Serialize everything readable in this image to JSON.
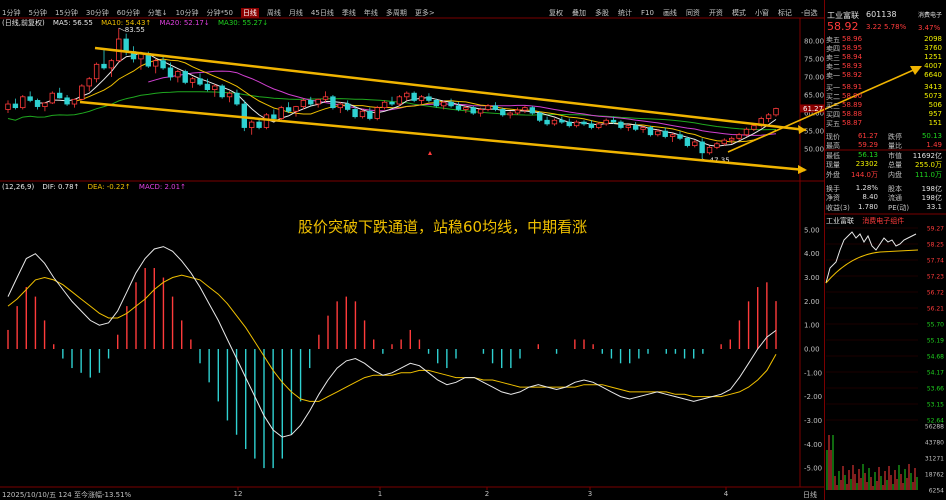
{
  "period_tabs": [
    "1分钟",
    "5分钟",
    "15分钟",
    "30分钟",
    "60分钟",
    "分笔↓",
    "10分钟",
    "分钟*50",
    "日线",
    "周线",
    "月线",
    "45日线",
    "季线",
    "年线",
    "多周期",
    "更多>"
  ],
  "active_tab": "日线",
  "toolbar": [
    "复权",
    "叠加",
    "多股",
    "统计",
    "F10",
    "画线",
    "同资",
    "开资",
    "模式",
    "小窗",
    "标记",
    "-自选"
  ],
  "price_indicator": {
    "prefix": "(日线,前复权)",
    "ma5": "MA5: 56.55",
    "ma10": "MA10: 54.43↑",
    "ma20": "MA20: 52.17↓",
    "ma30": "MA30: 55.27↓"
  },
  "macd_indicator": {
    "prefix": "(12,26,9)",
    "dif": "DIF: 0.78↑",
    "dea": "DEA: -0.22↑",
    "macd": "MACD: 2.01↑"
  },
  "annotation": "股价突破下跌通道，站稳60均线，中期看涨",
  "footer_text": "12025/10/10/五 124 至今涨幅-13.51%",
  "x_ticks": [
    "12",
    "1",
    "2",
    "3",
    "4"
  ],
  "period_label_bottom": "日线",
  "top_right_tag": "消费电子",
  "chart_data": [
    {
      "type": "candlestick",
      "price_axis_ticks": [
        "80.00",
        "75.00",
        "70.00",
        "65.00",
        "60.00",
        "55.00",
        "50.00"
      ],
      "ylim": [
        47,
        83
      ],
      "current_price_label": "61.27",
      "high_marker": "83.55",
      "low_marker": "47.35",
      "annotations": [
        "downtrend channel upper line",
        "downtrend channel lower line",
        "breakout arrow"
      ],
      "candles": [
        [
          61,
          63.5,
          60,
          62.5
        ],
        [
          62.5,
          64,
          61,
          61.5
        ],
        [
          61.5,
          65,
          61,
          64.5
        ],
        [
          64.5,
          66,
          63,
          63.5
        ],
        [
          63.5,
          64,
          61,
          61.8
        ],
        [
          61.8,
          63,
          60.5,
          62.8
        ],
        [
          62.8,
          66,
          62.5,
          65.5
        ],
        [
          65.5,
          67,
          64,
          64.2
        ],
        [
          64.2,
          65,
          62,
          62.5
        ],
        [
          62.5,
          64,
          61.5,
          63.8
        ],
        [
          63.8,
          68,
          63.5,
          67.5
        ],
        [
          67.5,
          70,
          66,
          69.5
        ],
        [
          69.5,
          74,
          68.5,
          73.5
        ],
        [
          73.5,
          78,
          72,
          72.5
        ],
        [
          72.5,
          75,
          70,
          74.5
        ],
        [
          74.5,
          83.55,
          74,
          80.5
        ],
        [
          80.5,
          82,
          76,
          77
        ],
        [
          77,
          78.5,
          74,
          75
        ],
        [
          75,
          77,
          72,
          76.5
        ],
        [
          76.5,
          77,
          72.5,
          73
        ],
        [
          73,
          75,
          71,
          74.5
        ],
        [
          74.5,
          76,
          72,
          72.5
        ],
        [
          72.5,
          74,
          69,
          70
        ],
        [
          70,
          72,
          68.5,
          71.5
        ],
        [
          71.5,
          72,
          68,
          68.5
        ],
        [
          68.5,
          70,
          67,
          69.5
        ],
        [
          69.5,
          71,
          67.5,
          68
        ],
        [
          68,
          69.5,
          66,
          66.5
        ],
        [
          66.5,
          68,
          64.5,
          67.5
        ],
        [
          67.5,
          68,
          64,
          64.5
        ],
        [
          64.5,
          66,
          63,
          65.5
        ],
        [
          65.5,
          66.5,
          62,
          62.5
        ],
        [
          62.5,
          63.5,
          55,
          56
        ],
        [
          56,
          58,
          54,
          57.5
        ],
        [
          57.5,
          58.5,
          55.5,
          56
        ],
        [
          56,
          60,
          55.5,
          59.5
        ],
        [
          59.5,
          61,
          58,
          58.5
        ],
        [
          58.5,
          62,
          58,
          61.5
        ],
        [
          61.5,
          63,
          60,
          60.5
        ],
        [
          60.5,
          62,
          59,
          61.8
        ],
        [
          61.8,
          64,
          61,
          63.5
        ],
        [
          63.5,
          64.5,
          62,
          62.5
        ],
        [
          62.5,
          64,
          61.5,
          63.8
        ],
        [
          63.8,
          66,
          63,
          64.5
        ],
        [
          64.5,
          65,
          61,
          61.5
        ],
        [
          61.5,
          63,
          60,
          62.5
        ],
        [
          62.5,
          63.5,
          60.5,
          61
        ],
        [
          61,
          62,
          58.5,
          59
        ],
        [
          59,
          61,
          58.5,
          60.5
        ],
        [
          60.5,
          61.5,
          58,
          58.5
        ],
        [
          58.5,
          62,
          58,
          61.5
        ],
        [
          61.5,
          63.5,
          61,
          63
        ],
        [
          63,
          64.5,
          62,
          62.5
        ],
        [
          62.5,
          65,
          62,
          64.5
        ],
        [
          64.5,
          66,
          63.5,
          65.5
        ],
        [
          65.5,
          66,
          63,
          63.5
        ],
        [
          63.5,
          65,
          62.5,
          64.5
        ],
        [
          64.5,
          65.5,
          63,
          63.5
        ],
        [
          63.5,
          64,
          61.5,
          62
        ],
        [
          62,
          63.5,
          61,
          63
        ],
        [
          63,
          64,
          61.5,
          62
        ],
        [
          62,
          63,
          60.5,
          61
        ],
        [
          61,
          62,
          60,
          61.5
        ],
        [
          61.5,
          62,
          59.5,
          60
        ],
        [
          60,
          61.5,
          59,
          61
        ],
        [
          61,
          62.5,
          60.5,
          62
        ],
        [
          62,
          63,
          60.5,
          61
        ],
        [
          61,
          61.5,
          59,
          59.5
        ],
        [
          59.5,
          60.5,
          58.5,
          60
        ],
        [
          60,
          61.5,
          59.5,
          60.8
        ],
        [
          60.8,
          62,
          60,
          61.5
        ],
        [
          61.5,
          62,
          59.5,
          60
        ],
        [
          60,
          60.5,
          57.5,
          58
        ],
        [
          58,
          59,
          56.5,
          57
        ],
        [
          57,
          58.5,
          56.5,
          58
        ],
        [
          58,
          59,
          57,
          57.5
        ],
        [
          57.5,
          58.5,
          56,
          56.5
        ],
        [
          56.5,
          58,
          56,
          57.5
        ],
        [
          57.5,
          58,
          56.5,
          57
        ],
        [
          57,
          58,
          55.5,
          56
        ],
        [
          56,
          57.5,
          55.5,
          57
        ],
        [
          57,
          58.5,
          56.5,
          58
        ],
        [
          58,
          59,
          57,
          57.5
        ],
        [
          57.5,
          58,
          55.5,
          56
        ],
        [
          56,
          57,
          55,
          56.5
        ],
        [
          56.5,
          57.5,
          55,
          55.5
        ],
        [
          55.5,
          56.5,
          54.5,
          56
        ],
        [
          56,
          56.5,
          53.5,
          54
        ],
        [
          54,
          55.5,
          53.5,
          55
        ],
        [
          55,
          56,
          53,
          53.5
        ],
        [
          53.5,
          54.5,
          52,
          54
        ],
        [
          54,
          55,
          52.5,
          53
        ],
        [
          53,
          53.5,
          50.5,
          51
        ],
        [
          51,
          52.5,
          50.5,
          52
        ],
        [
          52,
          53,
          47.35,
          49
        ],
        [
          49,
          51,
          48.5,
          50.5
        ],
        [
          50.5,
          52,
          50,
          51.5
        ],
        [
          51.5,
          53,
          51,
          52.5
        ],
        [
          52.5,
          53.5,
          51.5,
          53
        ],
        [
          53,
          54.5,
          52.5,
          54
        ],
        [
          54,
          56,
          53.5,
          55.5
        ],
        [
          55.5,
          57,
          55,
          56.5
        ],
        [
          56.5,
          59,
          56,
          58.5
        ],
        [
          58.5,
          60,
          57.5,
          59.5
        ],
        [
          59.5,
          61.5,
          59,
          61.27
        ]
      ]
    },
    {
      "type": "macd",
      "axis_ticks": [
        "5.00",
        "4.00",
        "3.00",
        "2.00",
        "1.00",
        "0.00",
        "-1.00",
        "-2.00",
        "-3.00",
        "-4.00",
        "-5.00"
      ],
      "ylim": [
        -5.5,
        5.5
      ],
      "dif": [
        2.2,
        3.0,
        3.8,
        4.0,
        3.6,
        3.0,
        2.5,
        2.0,
        1.6,
        1.2,
        1.0,
        1.1,
        1.6,
        2.4,
        3.2,
        3.8,
        4.2,
        4.3,
        4.1,
        3.7,
        3.2,
        2.6,
        1.9,
        1.2,
        0.4,
        -0.4,
        -1.2,
        -2.0,
        -2.8,
        -3.4,
        -3.7,
        -3.6,
        -3.2,
        -2.6,
        -1.9,
        -1.3,
        -0.8,
        -0.5,
        -0.4,
        -0.6,
        -0.9,
        -1.1,
        -1.0,
        -0.8,
        -0.6,
        -0.7,
        -1.0,
        -1.3,
        -1.5,
        -1.4,
        -1.2,
        -1.2,
        -1.4,
        -1.6,
        -1.8,
        -1.9,
        -1.8,
        -1.6,
        -1.5,
        -1.6,
        -1.7,
        -1.6,
        -1.4,
        -1.3,
        -1.4,
        -1.6,
        -1.8,
        -2.0,
        -2.1,
        -2.0,
        -1.9,
        -1.8,
        -1.9,
        -2.0,
        -2.1,
        -2.2,
        -2.1,
        -2.0,
        -1.9,
        -1.7,
        -1.2,
        -0.6,
        0.0,
        0.5,
        0.78
      ],
      "dea": [
        1.8,
        2.1,
        2.5,
        2.9,
        3.0,
        2.9,
        2.7,
        2.4,
        2.1,
        1.8,
        1.5,
        1.3,
        1.3,
        1.5,
        1.8,
        2.1,
        2.5,
        2.8,
        3.0,
        3.1,
        3.0,
        2.9,
        2.6,
        2.3,
        1.9,
        1.4,
        0.9,
        0.3,
        -0.3,
        -0.9,
        -1.4,
        -1.8,
        -2.1,
        -2.2,
        -2.2,
        -2.0,
        -1.8,
        -1.6,
        -1.4,
        -1.2,
        -1.1,
        -1.1,
        -1.1,
        -1.0,
        -1.0,
        -0.9,
        -0.9,
        -1.0,
        -1.1,
        -1.2,
        -1.2,
        -1.2,
        -1.3,
        -1.3,
        -1.4,
        -1.5,
        -1.6,
        -1.6,
        -1.6,
        -1.6,
        -1.6,
        -1.6,
        -1.6,
        -1.5,
        -1.5,
        -1.5,
        -1.6,
        -1.7,
        -1.8,
        -1.8,
        -1.8,
        -1.8,
        -1.8,
        -1.9,
        -1.9,
        -2.0,
        -2.0,
        -2.0,
        -2.0,
        -1.9,
        -1.8,
        -1.6,
        -1.3,
        -0.9,
        -0.22
      ],
      "hist": [
        0.8,
        1.8,
        2.6,
        2.2,
        1.2,
        0.2,
        -0.4,
        -0.8,
        -1.0,
        -1.2,
        -1.0,
        -0.4,
        0.6,
        1.8,
        2.8,
        3.4,
        3.4,
        3.0,
        2.2,
        1.2,
        0.4,
        -0.6,
        -1.4,
        -2.2,
        -3.0,
        -3.6,
        -4.2,
        -4.6,
        -5.0,
        -5.0,
        -4.6,
        -3.6,
        -2.2,
        -0.8,
        0.6,
        1.4,
        2.0,
        2.2,
        2.0,
        1.2,
        0.4,
        -0.2,
        0.2,
        0.4,
        0.8,
        0.4,
        -0.2,
        -0.6,
        -0.8,
        -0.4,
        0.0,
        0.0,
        -0.2,
        -0.6,
        -0.8,
        -0.8,
        -0.4,
        0.0,
        0.2,
        0.0,
        -0.2,
        0.0,
        0.4,
        0.4,
        0.2,
        -0.2,
        -0.4,
        -0.6,
        -0.6,
        -0.4,
        -0.2,
        0.0,
        -0.2,
        -0.2,
        -0.4,
        -0.4,
        -0.2,
        0.0,
        0.2,
        0.4,
        1.2,
        2.0,
        2.6,
        2.8,
        2.01
      ]
    }
  ],
  "quote_panel": {
    "name": "工业富联",
    "code": "601138",
    "price": "58.92",
    "change": "3.22",
    "change_pct": "5.78%",
    "side_pct": "3.47%",
    "asks": [
      {
        "label": "卖五",
        "price": "58.96",
        "vol": "2098"
      },
      {
        "label": "卖四",
        "price": "58.95",
        "vol": "3760"
      },
      {
        "label": "卖三",
        "price": "58.94",
        "vol": "1251"
      },
      {
        "label": "卖二",
        "price": "58.93",
        "vol": "4007"
      },
      {
        "label": "卖一",
        "price": "58.92",
        "vol": "6640"
      }
    ],
    "bids": [
      {
        "label": "买一",
        "price": "58.91",
        "vol": "3413"
      },
      {
        "label": "买二",
        "price": "58.90",
        "vol": "5073"
      },
      {
        "label": "买三",
        "price": "58.89",
        "vol": "506"
      },
      {
        "label": "买四",
        "price": "58.88",
        "vol": "957"
      },
      {
        "label": "买五",
        "price": "58.87",
        "vol": "151"
      }
    ],
    "stats": [
      {
        "l1": "现价",
        "v1": "61.27",
        "l2": "跌停",
        "v2": "50.13"
      },
      {
        "l1": "最高",
        "v1": "59.29",
        "l2": "量比",
        "v2": "1.49"
      },
      {
        "l1": "最低",
        "v1": "56.13",
        "l2": "市值",
        "v2": "11692亿"
      },
      {
        "l1": "现量",
        "v1": "23302",
        "l2": "总量",
        "v2": "255.0万"
      },
      {
        "l1": "外盘",
        "v1": "144.0万",
        "l2": "内盘",
        "v2": "111.0万"
      },
      {
        "l1": "换手",
        "v1": "1.28%",
        "l2": "股本",
        "v2": "198亿"
      },
      {
        "l1": "净资",
        "v1": "8.40",
        "l2": "流通",
        "v2": "198亿"
      },
      {
        "l1": "收益(3)",
        "v1": "1.780",
        "l2": "PE(动)",
        "v2": "33.1"
      }
    ],
    "mini_tabs": [
      "工业富联",
      "消费电子组件"
    ],
    "mini_price_ticks": [
      "59.27",
      "58.25",
      "57.74",
      "57.23",
      "56.72",
      "56.21",
      "55.70",
      "55.19",
      "54.68",
      "54.17",
      "53.66",
      "53.15",
      "52.64"
    ],
    "mini_vol_ticks": [
      "56288",
      "43780",
      "31271",
      "18762",
      "6254"
    ]
  }
}
